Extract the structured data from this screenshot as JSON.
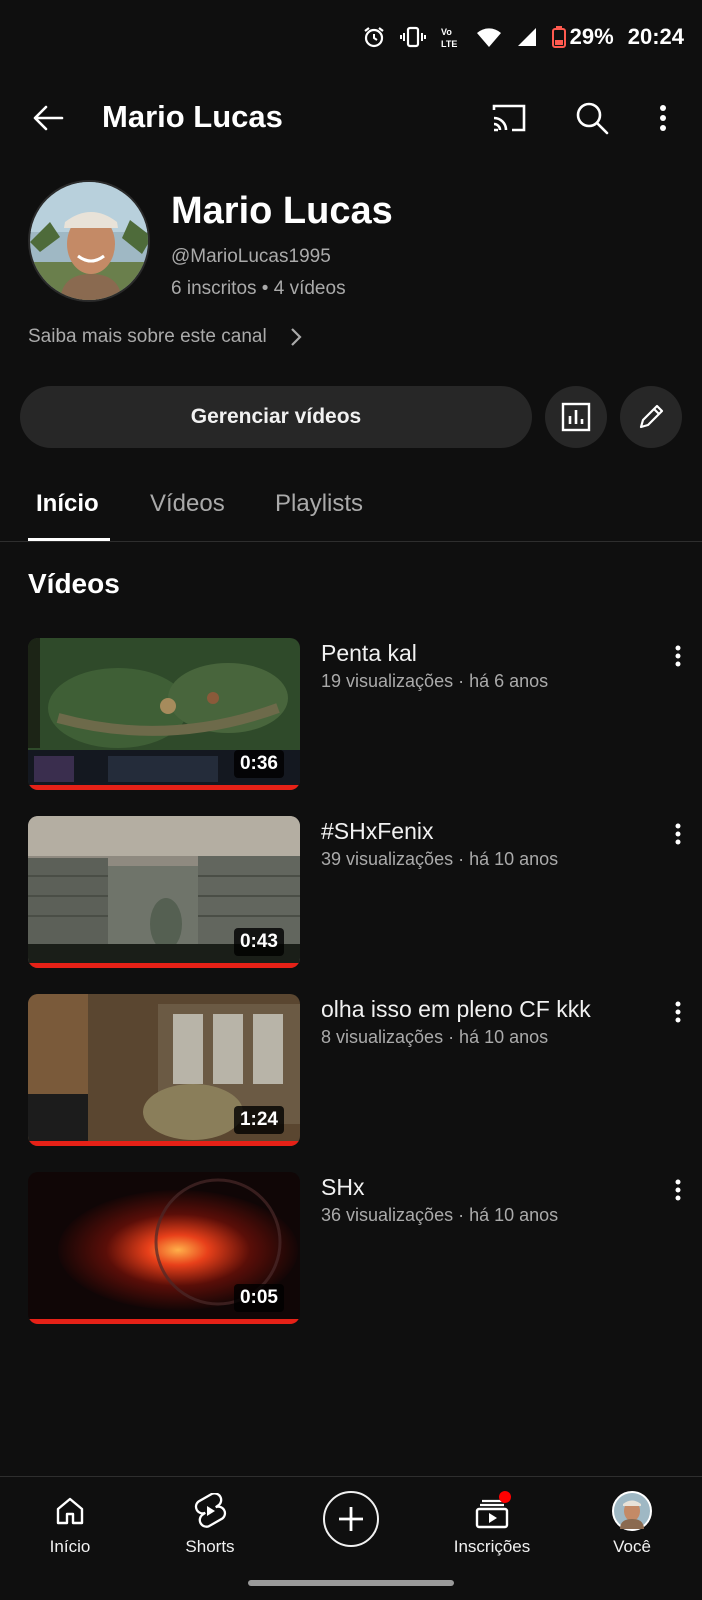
{
  "status": {
    "battery": "29%",
    "time": "20:24",
    "network_label": "Vo LTE"
  },
  "header": {
    "title": "Mario Lucas",
    "back_icon": "arrow-left-icon",
    "cast_icon": "cast-icon",
    "search_icon": "search-icon",
    "more_icon": "more-vertical-icon"
  },
  "channel": {
    "name": "Mario Lucas",
    "handle": "@MarioLucas1995",
    "stats": "6 inscritos • 4 vídeos",
    "about_link": "Saiba mais sobre este canal",
    "manage_button": "Gerenciar vídeos"
  },
  "tabs": [
    {
      "label": "Início",
      "active": true
    },
    {
      "label": "Vídeos",
      "active": false
    },
    {
      "label": "Playlists",
      "active": false
    }
  ],
  "section_title": "Vídeos",
  "videos": [
    {
      "title": "Penta kal",
      "meta": "19 visualizações · há 6 anos",
      "duration": "0:36",
      "progress": 1.0
    },
    {
      "title": "#SHxFenix",
      "meta": "39 visualizações · há 10 anos",
      "duration": "0:43",
      "progress": 1.0
    },
    {
      "title": "olha  isso  em pleno CF kkk",
      "meta": "8 visualizações · há 10 anos",
      "duration": "1:24",
      "progress": 1.0
    },
    {
      "title": "SHx",
      "meta": "36 visualizações · há 10 anos",
      "duration": "0:05",
      "progress": 1.0
    }
  ],
  "bottom_nav": [
    {
      "label": "Início",
      "icon": "home-icon"
    },
    {
      "label": "Shorts",
      "icon": "shorts-icon"
    },
    {
      "label": "",
      "icon": "create-plus-icon"
    },
    {
      "label": "Inscrições",
      "icon": "subscriptions-icon"
    },
    {
      "label": "Você",
      "icon": "avatar"
    }
  ],
  "colors": {
    "background": "#0f0f0f",
    "progress_red": "#e62117",
    "secondary_text": "#aaaaaa",
    "button_bg": "#272727"
  }
}
